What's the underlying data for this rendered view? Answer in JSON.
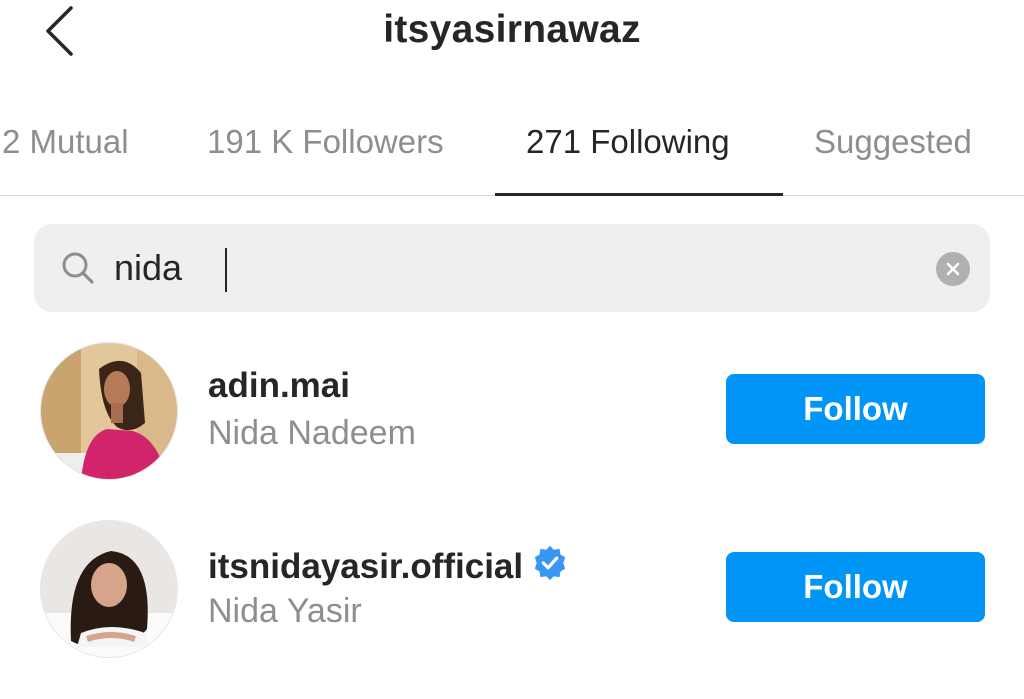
{
  "header": {
    "title": "itsyasirnawaz"
  },
  "tabs": [
    {
      "label": "2 Mutual",
      "active": false
    },
    {
      "label": "191 K Followers",
      "active": false
    },
    {
      "label": "271 Following",
      "active": true
    },
    {
      "label": "Suggested",
      "active": false
    }
  ],
  "search": {
    "value": "nida",
    "icon": "search-icon",
    "clear_icon": "clear-icon"
  },
  "results": [
    {
      "username": "adin.mai",
      "full_name": "Nida Nadeem",
      "verified": false,
      "button_label": "Follow"
    },
    {
      "username": "itsnidayasir.official",
      "full_name": "Nida Yasir",
      "verified": true,
      "button_label": "Follow"
    }
  ],
  "colors": {
    "accent": "#0095f6",
    "verified": "#3897f0",
    "muted_text": "#8e8e8e",
    "primary_text": "#262626",
    "search_bg": "#efefef"
  }
}
